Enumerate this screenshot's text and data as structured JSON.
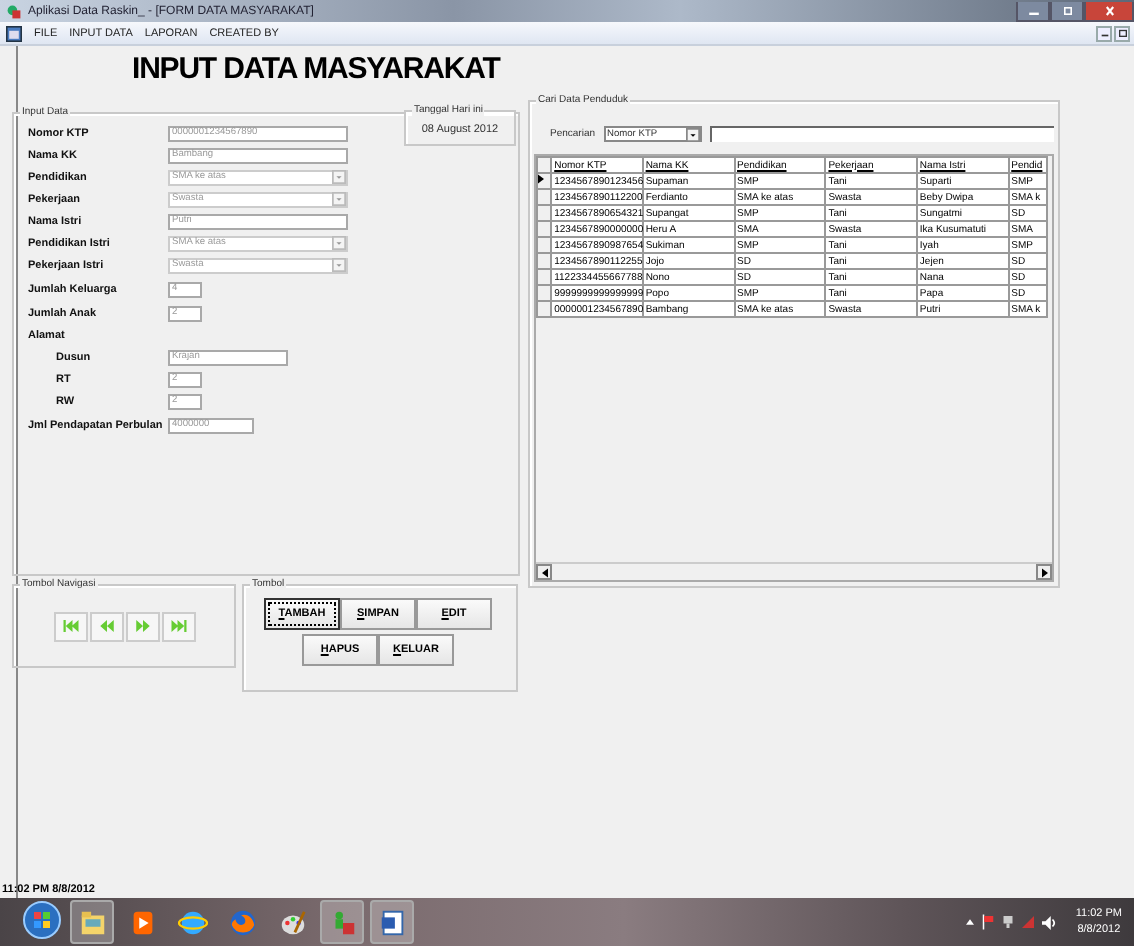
{
  "window": {
    "title": "Aplikasi Data Raskin_ - [FORM DATA MASYARAKAT]"
  },
  "menu": [
    "FILE",
    "INPUT DATA",
    "LAPORAN",
    "CREATED BY"
  ],
  "heading": "INPUT DATA MASYARAKAT",
  "input_group": {
    "title": "Input Data",
    "fields": [
      {
        "label": "Nomor KTP",
        "kind": "text",
        "value": "0000001234567890",
        "disabled": true
      },
      {
        "label": "Nama KK",
        "kind": "text",
        "value": "Bambang",
        "disabled": true
      },
      {
        "label": "Pendidikan",
        "kind": "combo",
        "value": "SMA ke atas",
        "disabled": true
      },
      {
        "label": "Pekerjaan",
        "kind": "combo",
        "value": "Swasta",
        "disabled": true
      },
      {
        "label": "Nama Istri",
        "kind": "text",
        "value": "Putri",
        "disabled": true
      },
      {
        "label": "Pendidikan Istri",
        "kind": "combo",
        "value": "SMA ke atas",
        "disabled": true
      },
      {
        "label": "Pekerjaan Istri",
        "kind": "combo",
        "value": "Swasta",
        "disabled": true
      },
      {
        "label": "Jumlah Keluarga",
        "kind": "number",
        "value": "4",
        "disabled": true
      },
      {
        "label": "Jumlah Anak",
        "kind": "number",
        "value": "2",
        "disabled": true
      },
      {
        "label": "Alamat",
        "kind": "heading",
        "children": [
          {
            "label": "Dusun",
            "kind": "text",
            "value": "Krajan",
            "disabled": true
          },
          {
            "label": "RT",
            "kind": "number",
            "value": "2",
            "disabled": true
          },
          {
            "label": "RW",
            "kind": "number",
            "value": "2",
            "disabled": true
          }
        ]
      },
      {
        "label": "Jml Pendapatan Perbulan",
        "kind": "number",
        "value": "4000000",
        "disabled": true
      }
    ]
  },
  "date_box": {
    "title": "Tanggal Hari ini",
    "value": "08 August 2012"
  },
  "navigation": {
    "title": "Tombol Navigasi",
    "buttons": [
      {
        "kind": "first"
      },
      {
        "kind": "previous"
      },
      {
        "kind": "next"
      },
      {
        "kind": "last"
      }
    ]
  },
  "actions": {
    "title": "Tombol",
    "buttons": [
      {
        "label": "TAMBAH",
        "focused": true
      },
      {
        "label": "SIMPAN",
        "focused": false
      },
      {
        "label": "EDIT",
        "focused": false
      },
      {
        "label": "HAPUS",
        "focused": false
      },
      {
        "label": "KELUAR",
        "focused": false
      }
    ]
  },
  "search_group": {
    "title": "Cari Data Penduduk",
    "search_label": "Pencarian",
    "search_by": "Nomor KTP"
  },
  "table": {
    "columns": [
      "Nomor KTP",
      "Nama KK",
      "Pendidikan",
      "Pekerjaan",
      "Nama Istri",
      "Pendid"
    ],
    "rows": [
      {
        "selected": true,
        "cells": [
          "1234567890123456",
          "Supaman",
          "SMP",
          "Tani",
          "Suparti",
          "SMP"
        ]
      },
      {
        "selected": false,
        "cells": [
          "1234567890112200",
          "Ferdianto",
          "SMA ke atas",
          "Swasta",
          "Beby Dwipa",
          "SMA k"
        ]
      },
      {
        "selected": false,
        "cells": [
          "1234567890654321",
          "Supangat",
          "SMP",
          "Tani",
          "Sungatmi",
          "SD"
        ]
      },
      {
        "selected": false,
        "cells": [
          "1234567890000000",
          "Heru A",
          "SMA",
          "Swasta",
          "Ika Kusumatuti",
          "SMA"
        ]
      },
      {
        "selected": false,
        "cells": [
          "1234567890987654",
          "Sukiman",
          "SMP",
          "Tani",
          "Iyah",
          "SMP"
        ]
      },
      {
        "selected": false,
        "cells": [
          "1234567890112255",
          "Jojo",
          "SD",
          "Tani",
          "Jejen",
          "SD"
        ]
      },
      {
        "selected": false,
        "cells": [
          "1122334455667788",
          "Nono",
          "SD",
          "Tani",
          "Nana",
          "SD"
        ]
      },
      {
        "selected": false,
        "cells": [
          "9999999999999999",
          "Popo",
          "SMP",
          "Tani",
          "Papa",
          "SD"
        ]
      },
      {
        "selected": false,
        "cells": [
          "0000001234567890",
          "Bambang",
          "SMA ke atas",
          "Swasta",
          "Putri",
          "SMA k"
        ]
      }
    ]
  },
  "status_bar": "11:02 PM  8/8/2012",
  "taskbar": {
    "apps": [
      {
        "kind": "folder"
      },
      {
        "kind": "media"
      },
      {
        "kind": "browser"
      },
      {
        "kind": "firefox"
      },
      {
        "kind": "paint"
      },
      {
        "kind": "app"
      },
      {
        "kind": "word"
      }
    ],
    "time": "11:02 PM",
    "date": "8/8/2012"
  }
}
